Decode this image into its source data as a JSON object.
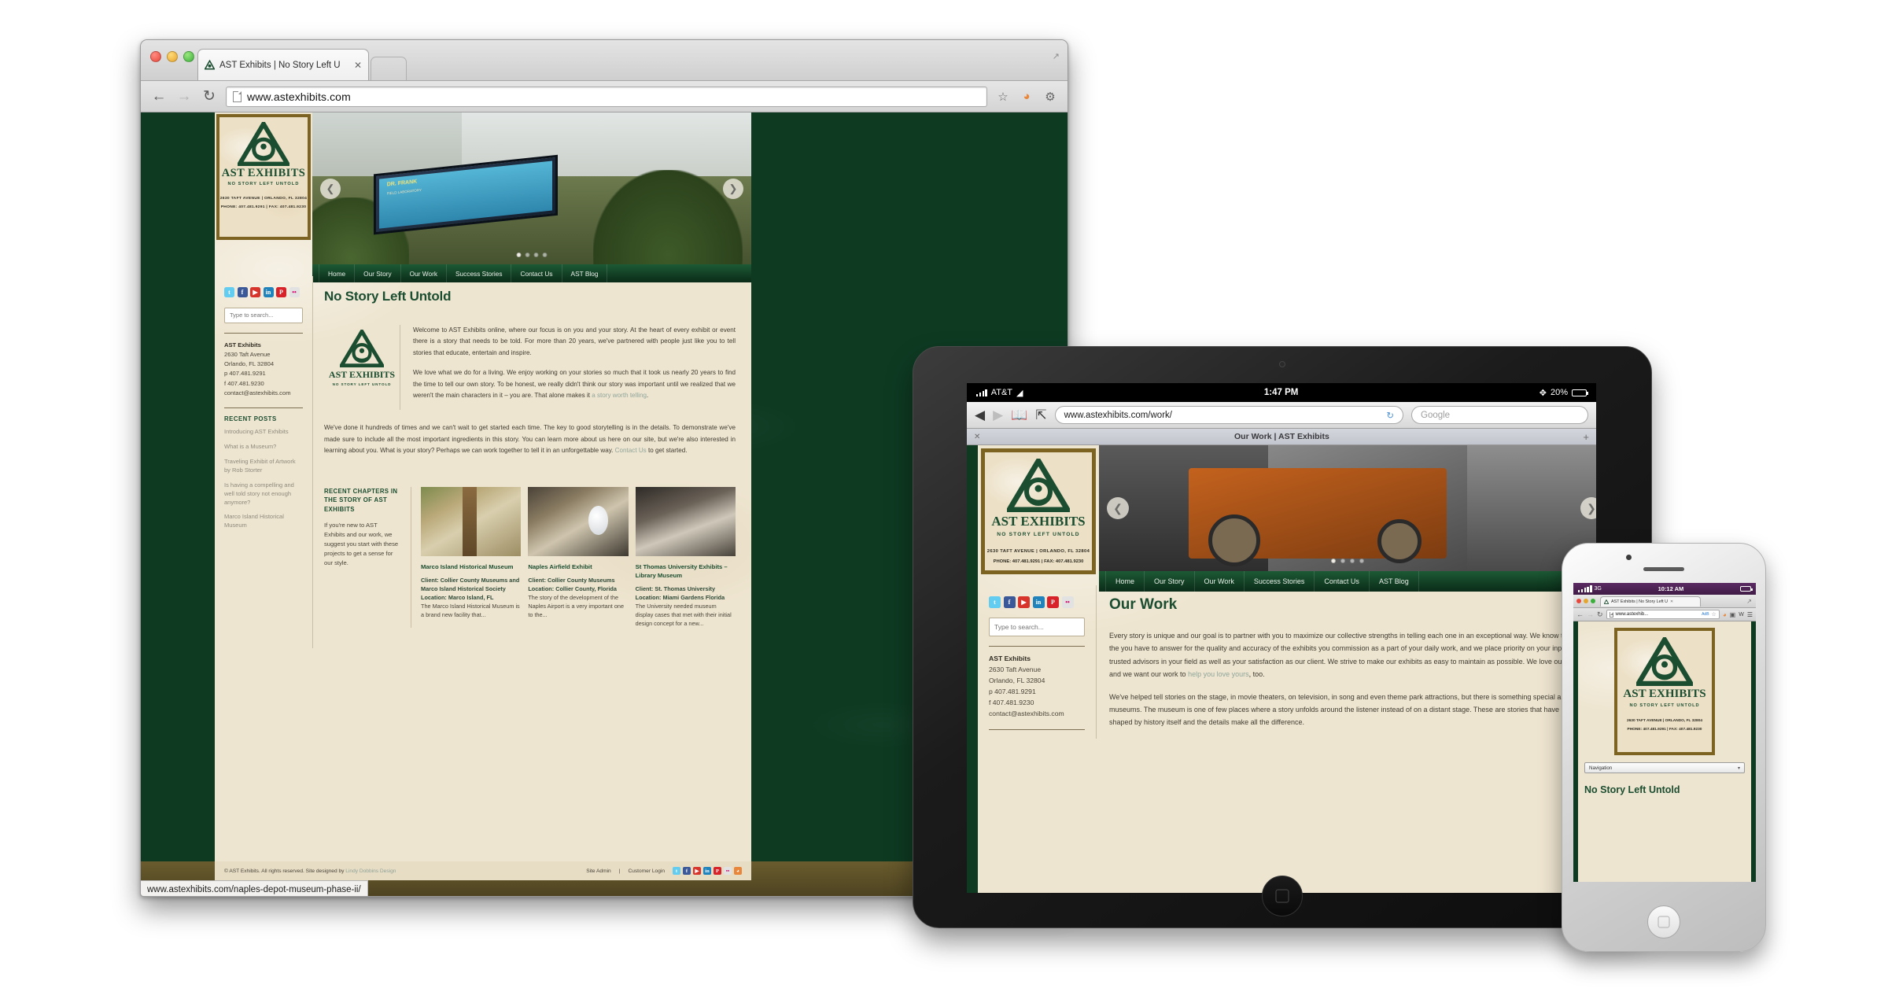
{
  "desktop": {
    "tab_title": "AST Exhibits | No Story Left U",
    "url": "www.astexhibits.com",
    "status_url": "www.astexhibits.com/naples-depot-museum-phase-ii/",
    "back_icon": "back-arrow-icon",
    "forward_icon": "forward-arrow-icon",
    "reload_icon": "reload-icon",
    "star_icon": "star-icon",
    "rss_icon": "rss-icon",
    "wrench_icon": "wrench-icon",
    "maximize_icon": "maximize-icon"
  },
  "site": {
    "logo": {
      "name": "AST EXHIBITS",
      "tagline": "NO STORY LEFT UNTOLD",
      "address": "2630 TAFT AVENUE | ORLANDO, FL 32804",
      "phone": "PHONE: 407.481.9291 | FAX: 407.481.9230"
    },
    "nav": [
      "Home",
      "Our Story",
      "Our Work",
      "Success Stories",
      "Contact Us",
      "AST Blog"
    ],
    "hero": {
      "sign_title": "DR. FRANK",
      "sign_sub": "FIELD LABORATORY",
      "prev_icon": "chevron-left-icon",
      "next_icon": "chevron-right-icon",
      "slide_count": 4,
      "active_slide": 1
    },
    "sidebar": {
      "social": [
        {
          "name": "twitter-icon",
          "glyph": "t"
        },
        {
          "name": "facebook-icon",
          "glyph": "f"
        },
        {
          "name": "youtube-icon",
          "glyph": "▶"
        },
        {
          "name": "linkedin-icon",
          "glyph": "in"
        },
        {
          "name": "pinterest-icon",
          "glyph": "P"
        },
        {
          "name": "flickr-icon",
          "glyph": "••"
        }
      ],
      "search_placeholder": "Type to search...",
      "company": "AST Exhibits",
      "address1": "2630 Taft Avenue",
      "address2": "Orlando, FL 32804",
      "phone": "p 407.481.9291",
      "fax": "f 407.481.9230",
      "email": "contact@astexhibits.com",
      "recent_heading": "RECENT POSTS",
      "recent_posts": [
        "Introducing AST Exhibits",
        "What is a Museum?",
        "Traveling Exhibit of Artwork by Rob Storter",
        "Is having a compelling and well told story not enough anymore?",
        "Marco Island Historical Museum"
      ]
    },
    "main": {
      "title": "No Story Left Untold",
      "para1": "Welcome to AST Exhibits online, where our focus is on you and your story. At the heart of every exhibit or event there is a story that needs to be told. For more than 20 years, we've partnered with people just like you to tell stories that educate, entertain and inspire.",
      "para2_a": "We love what we do for a living. We enjoy working on your stories so much that it took us nearly 20 years to find the time to tell our own story. To be honest, we really didn't think our story was important until we realized that we weren't the main characters in it – you are. That alone makes it ",
      "para2_link": "a story worth telling",
      "para2_b": ".",
      "para3_a": "We've done it hundreds of times and we can't wait to get started each time. The key to good storytelling is in the details. To demonstrate we've made sure to include all the most important ingredients in this story. You can learn more about us here on our site, but we're also interested in learning about you. What is your story? Perhaps we can work together to tell it in an unforgettable way. ",
      "para3_link": "Contact Us",
      "para3_b": " to get started."
    },
    "chapters": {
      "heading": "RECENT CHAPTERS IN THE STORY OF AST EXHIBITS",
      "blurb": "If you're new to AST Exhibits and our work, we suggest you start with these projects to get a sense for our style.",
      "cards": [
        {
          "title": "Marco Island Historical Museum",
          "client": "Client: Collier County Museums and Marco Island Historical Society",
          "location": "Location: Marco Island, FL",
          "excerpt": "The Marco Island Historical Museum is a brand new facility that..."
        },
        {
          "title": "Naples Airfield Exhibit",
          "client": "Client: Collier County Museums",
          "location": "Location: Collier County, Florida",
          "excerpt": "The story of the development of the Naples Airport is a very important one to the..."
        },
        {
          "title": "St Thomas University Exhibits – Library Museum",
          "client": "Client: St. Thomas University",
          "location": "Location: Miami Gardens Florida",
          "excerpt": "The University needed museum display cases that met with their initial design concept for a new..."
        }
      ]
    },
    "footer": {
      "copyright": "© AST Exhibits. All rights reserved. Site designed by ",
      "designer": "Lindy Dobbins Design",
      "site_admin": "Site Admin",
      "separator": " | ",
      "customer_login": "Customer Login"
    }
  },
  "tablet": {
    "carrier": "AT&T",
    "wifi_icon": "wifi-icon",
    "time": "1:47 PM",
    "bluetooth_icon": "bluetooth-icon",
    "battery": "20%",
    "back_icon": "back-arrow-icon",
    "forward_icon": "forward-arrow-icon",
    "bookmarks_icon": "book-icon",
    "share_icon": "share-icon",
    "url": "www.astexhibits.com/work/",
    "reload_icon": "reload-icon",
    "search_placeholder": "Google",
    "tab_title": "Our Work | AST Exhibits",
    "tab_close_icon": "close-icon",
    "tab_add_icon": "plus-icon",
    "page": {
      "title": "Our Work",
      "para1_a": "Every story is unique and our goal is to partner with you to maximize our collective strengths in telling each one in an exceptional way. We know that the you have to answer for the quality and accuracy of the exhibits you commission as a part of your daily work, and we place priority on your input as trusted advisors in your field as well as your satisfaction as our client. We strive to make our exhibits as easy to maintain as possible. We love our job, and we want our work to ",
      "para1_link": "help you love yours",
      "para1_b": ", too.",
      "para2": "We've helped tell stories on the stage, in movie theaters, on television, in song and even theme park attractions, but there is something special about museums. The museum is one of few places where a story unfolds around the listener instead of on a distant stage. These are stories that have been shaped by history itself and the details make all the difference."
    }
  },
  "phone": {
    "signal_icon": "signal-bars-icon",
    "network": "3G",
    "time": "10:12 AM",
    "battery_icon": "battery-icon",
    "tab_title": "AST Exhibits | No Story Left U",
    "url": "www.astexhib...",
    "adblock_label": "AdB",
    "star_icon": "star-icon",
    "rss_icon": "rss-icon",
    "screenshot_icon": "screenshot-icon",
    "w_icon": "w-icon",
    "menu_icon": "hamburger-menu-icon",
    "nav_select": "Navigation",
    "heading": "No Story Left Untold"
  }
}
